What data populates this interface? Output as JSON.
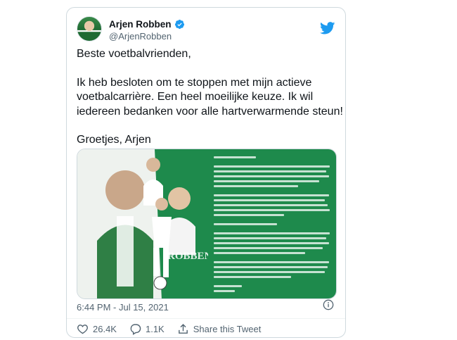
{
  "author": {
    "display_name": "Arjen Robben",
    "handle": "@ArjenRobben",
    "verified": true
  },
  "tweet": {
    "paragraphs": [
      "Beste voetbalvrienden,",
      "Ik heb besloten om te stoppen met mijn actieve voetbalcarrière. Een heel moeilijke keuze. Ik wil iedereen bedanken voor alle hartverwarmende steun!",
      "Groetjes, Arjen"
    ]
  },
  "media": {
    "poster_name": "ROBBEN"
  },
  "meta": {
    "timestamp": "6:44 PM - Jul 15, 2021"
  },
  "actions": {
    "likes": "26.4K",
    "replies": "1.1K",
    "share_label": "Share this Tweet"
  },
  "colors": {
    "twitter_blue": "#1d9bf0",
    "groningen_green": "#1e8a4c",
    "like_red": "#e0245e"
  },
  "icons": [
    "verified-icon",
    "twitter-bird-icon",
    "info-icon",
    "heart-icon",
    "reply-icon",
    "share-icon"
  ]
}
